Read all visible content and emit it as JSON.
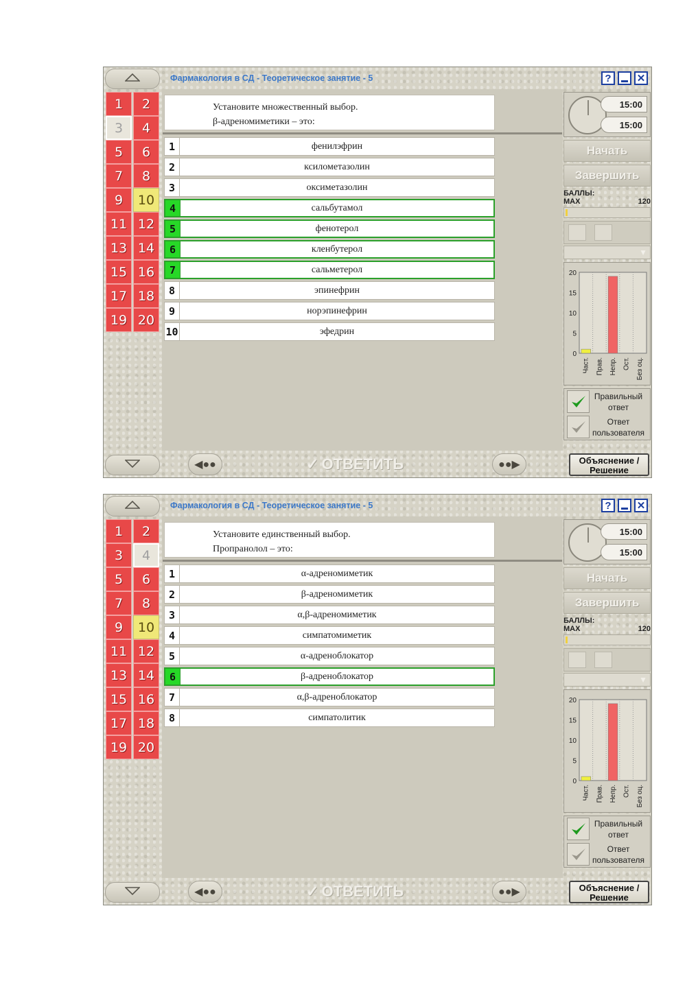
{
  "app_title": "Фармакология в СД - Теоретическое занятие - 5",
  "help_label": "?",
  "close_label": "✕",
  "question_numbers": [
    "1",
    "2",
    "3",
    "4",
    "5",
    "6",
    "7",
    "8",
    "9",
    "10",
    "11",
    "12",
    "13",
    "14",
    "15",
    "16",
    "17",
    "18",
    "19",
    "20"
  ],
  "timer": {
    "total": "15:00",
    "remaining": "15:00"
  },
  "buttons": {
    "start": "Начать",
    "finish": "Завершить",
    "answer": "ОТВЕТИТЬ",
    "explain_line1": "Объяснение /",
    "explain_line2": "Решение"
  },
  "score": {
    "label": "БАЛЛЫ:",
    "max_label": "MAX",
    "max_value": "120"
  },
  "legend": {
    "correct_line1": "Правильный",
    "correct_line2": "ответ",
    "user_line1": "Ответ",
    "user_line2": "пользователя"
  },
  "chart_data": {
    "type": "bar",
    "categories": [
      "Част.",
      "Прав.",
      "Непр.",
      "Ост.",
      "Без оц."
    ],
    "values": [
      1,
      0,
      19,
      0,
      0
    ],
    "yticks": [
      "0",
      "5",
      "10",
      "15",
      "20"
    ],
    "ylim": [
      0,
      20
    ],
    "bar_colors": [
      "#f0f040",
      "#f0f040",
      "#f06464",
      "#f06464",
      "#f06464"
    ]
  },
  "screens": [
    {
      "current": "3",
      "yellow": [
        "10"
      ],
      "prompt_line1": "Установите множественный выбор.",
      "prompt_line2": "β-адреномиметики – это:",
      "answers": [
        {
          "num": "1",
          "text": "фенилэфрин",
          "selected": false
        },
        {
          "num": "2",
          "text": "ксилометазолин",
          "selected": false
        },
        {
          "num": "3",
          "text": "оксиметазолин",
          "selected": false
        },
        {
          "num": "4",
          "text": "сальбутамол",
          "selected": true
        },
        {
          "num": "5",
          "text": "фенотерол",
          "selected": true
        },
        {
          "num": "6",
          "text": "кленбутерол",
          "selected": true
        },
        {
          "num": "7",
          "text": "сальметерол",
          "selected": true
        },
        {
          "num": "8",
          "text": "эпинефрин",
          "selected": false
        },
        {
          "num": "9",
          "text": "норэпинефрин",
          "selected": false
        },
        {
          "num": "10",
          "text": "эфедрин",
          "selected": false
        }
      ]
    },
    {
      "current": "4",
      "yellow": [
        "10"
      ],
      "prompt_line1": "Установите единственный выбор.",
      "prompt_line2": "Пропранолол – это:",
      "answers": [
        {
          "num": "1",
          "text": "α-адреномиметик",
          "selected": false
        },
        {
          "num": "2",
          "text": "β-адреномиметик",
          "selected": false
        },
        {
          "num": "3",
          "text": "α,β-адреномиметик",
          "selected": false
        },
        {
          "num": "4",
          "text": "симпатомиметик",
          "selected": false
        },
        {
          "num": "5",
          "text": "α-адреноблокатор",
          "selected": false
        },
        {
          "num": "6",
          "text": "β-адреноблокатор",
          "selected": true
        },
        {
          "num": "7",
          "text": "α,β-адреноблокатор",
          "selected": false
        },
        {
          "num": "8",
          "text": "симпатолитик",
          "selected": false
        }
      ]
    }
  ]
}
